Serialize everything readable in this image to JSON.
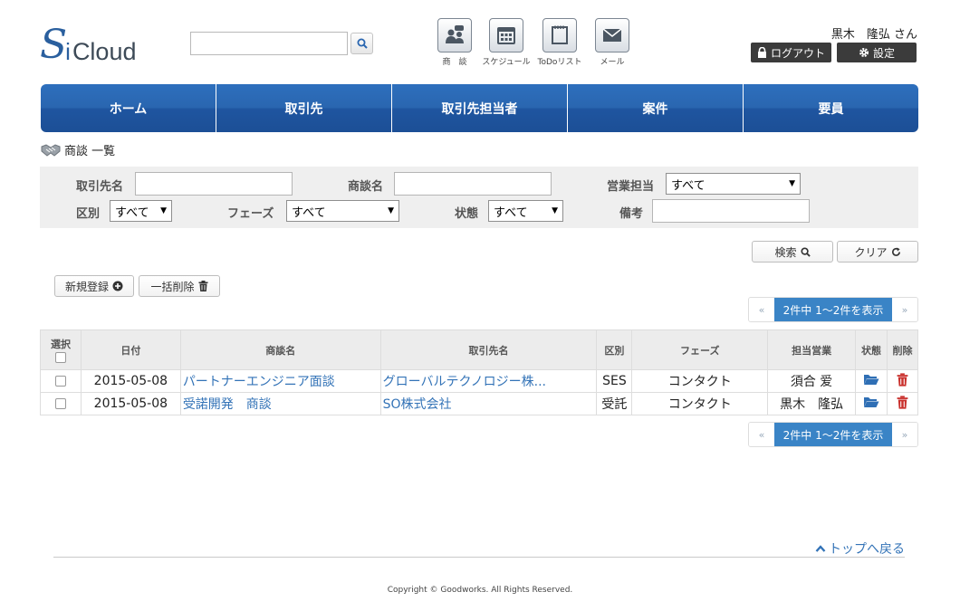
{
  "header": {
    "logo": {
      "s": "S",
      "i": "i",
      "cloud": "Cloud"
    },
    "search": {
      "value": "",
      "placeholder": ""
    },
    "quick": [
      {
        "name": "negotiation",
        "label": "商　談"
      },
      {
        "name": "schedule",
        "label": "スケジュール"
      },
      {
        "name": "todo",
        "label": "ToDoリスト"
      },
      {
        "name": "mail",
        "label": "メール"
      }
    ],
    "user": "黒木　隆弘 さん",
    "logout": "ログアウト",
    "settings": "設定"
  },
  "nav": [
    "ホーム",
    "取引先",
    "取引先担当者",
    "案件",
    "要員"
  ],
  "page_title": "商談 一覧",
  "filters": {
    "client_label": "取引先名",
    "client_value": "",
    "deal_label": "商談名",
    "deal_value": "",
    "sales_label": "営業担当",
    "sales_value": "すべて",
    "category_label": "区別",
    "category_value": "すべて",
    "phase_label": "フェーズ",
    "phase_value": "すべて",
    "status_label": "状態",
    "status_value": "すべて",
    "note_label": "備考",
    "note_value": ""
  },
  "actions": {
    "search": "検索",
    "clear": "クリア",
    "new": "新規登録",
    "bulk_delete": "一括削除"
  },
  "pager": {
    "prev": "«",
    "info": "2件中 1～2件を表示",
    "next": "»"
  },
  "table": {
    "headers": [
      "選択",
      "日付",
      "商談名",
      "取引先名",
      "区別",
      "フェーズ",
      "担当営業",
      "状態",
      "削除"
    ],
    "rows": [
      {
        "date": "2015-05-08",
        "deal": "パートナーエンジニア面談",
        "client": "グローバルテクノロジー株...",
        "category": "SES",
        "phase": "コンタクト",
        "sales": "須合 爱"
      },
      {
        "date": "2015-05-08",
        "deal": "受諾開発　商談",
        "client": "SO株式会社",
        "category": "受託",
        "phase": "コンタクト",
        "sales": "黒木　隆弘"
      }
    ]
  },
  "footer": {
    "back_top": "トップへ戻る",
    "copyright": "Copyright © Goodworks. All Rights Reserved."
  },
  "colors": {
    "primary": "#2a66b0",
    "link": "#3373b7",
    "pager": "#3a84c6",
    "folder": "#2f6fb5",
    "trash": "#c9302c"
  }
}
